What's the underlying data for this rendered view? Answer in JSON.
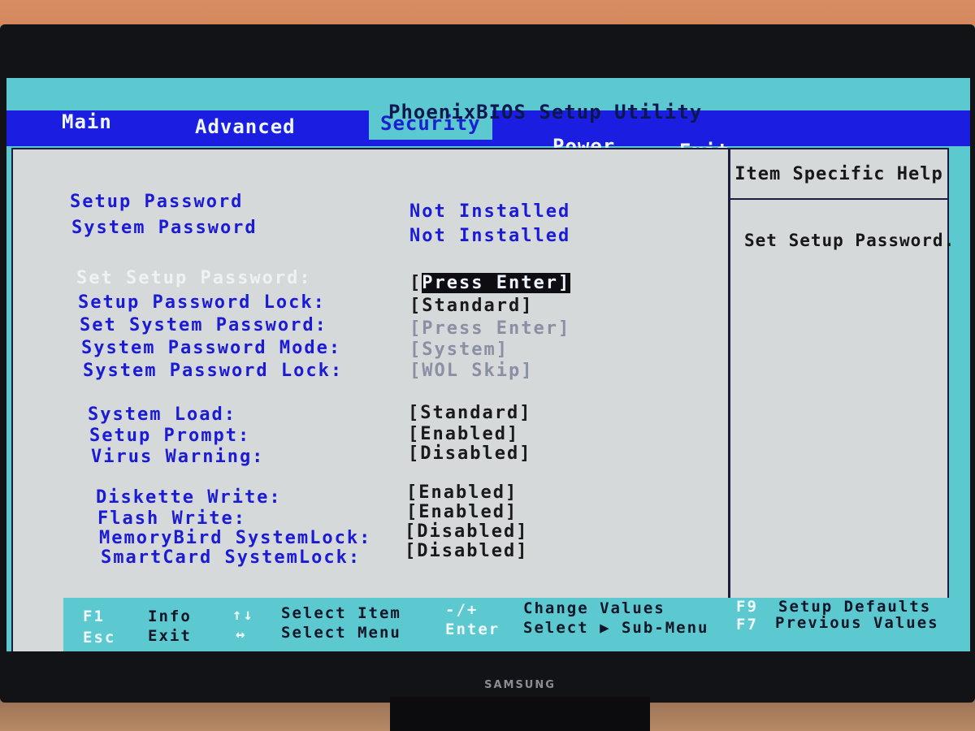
{
  "app": {
    "title": "PhoenixBIOS Setup Utility"
  },
  "menu": [
    {
      "label": "Main"
    },
    {
      "label": "Advanced"
    },
    {
      "label": "Security"
    },
    {
      "label": "Power"
    },
    {
      "label": "Exit"
    }
  ],
  "status": [
    {
      "label": "Setup Password",
      "value": "Not Installed"
    },
    {
      "label": "System Password",
      "value": "Not Installed"
    }
  ],
  "settings": [
    {
      "label": "Set Setup Password:",
      "value": "[Press Enter]",
      "selected": true
    },
    {
      "label": "Setup Password Lock:",
      "value": "[Standard]"
    },
    {
      "label": "Set System Password:",
      "value": "[Press Enter]",
      "disabled": true
    },
    {
      "label": "System Password Mode:",
      "value": "[System]",
      "disabled": true
    },
    {
      "label": "System Password Lock:",
      "value": "[WOL Skip]",
      "disabled": true
    },
    {
      "label": "System Load:",
      "value": "[Standard]"
    },
    {
      "label": "Setup Prompt:",
      "value": "[Enabled]"
    },
    {
      "label": "Virus Warning:",
      "value": "[Disabled]"
    },
    {
      "label": "Diskette Write:",
      "value": "[Enabled]"
    },
    {
      "label": "Flash Write:",
      "value": "[Enabled]"
    },
    {
      "label": "MemoryBird SystemLock:",
      "value": "[Disabled]"
    },
    {
      "label": "SmartCard SystemLock:",
      "value": "[Disabled]"
    }
  ],
  "help": {
    "title": "Item Specific Help",
    "text": "Set Setup Password."
  },
  "footer": [
    {
      "key": "F1",
      "desc": "Info"
    },
    {
      "key": "Esc",
      "desc": "Exit"
    },
    {
      "key": "↑↓",
      "desc": "Select Item"
    },
    {
      "key": "↔",
      "desc": "Select Menu"
    },
    {
      "key": "-/+",
      "desc": "Change Values"
    },
    {
      "key": "Enter",
      "desc": "Select ▶ Sub-Menu"
    },
    {
      "key": "F9",
      "desc": "Setup Defaults"
    },
    {
      "key": "F7",
      "desc": "Previous Values"
    }
  ],
  "monitor": {
    "brand": "SAMSUNG"
  },
  "colors": {
    "background": "#5cc9d0",
    "menubar": "#1b1ee0",
    "panel": "#d6d9da",
    "label": "#1b1bd6"
  }
}
